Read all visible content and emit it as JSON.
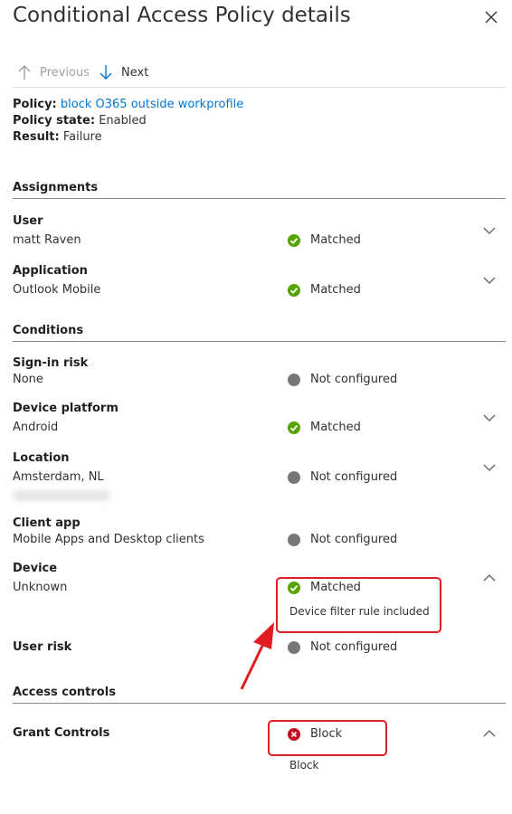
{
  "title": "Conditional Access Policy details",
  "nav": {
    "previous": "Previous",
    "next": "Next"
  },
  "policy": {
    "policy_label": "Policy:",
    "policy_value": "block O365 outside workprofile",
    "state_label": "Policy state:",
    "state_value": "Enabled",
    "result_label": "Result:",
    "result_value": "Failure"
  },
  "sections": {
    "assignments": "Assignments",
    "conditions": "Conditions",
    "access_controls": "Access controls"
  },
  "assignments": [
    {
      "label": "User",
      "value": "matt Raven",
      "status": "Matched"
    },
    {
      "label": "Application",
      "value": "Outlook Mobile",
      "status": "Matched"
    }
  ],
  "conditions": [
    {
      "label": "Sign-in risk",
      "value": "None",
      "status": "Not configured"
    },
    {
      "label": "Device platform",
      "value": "Android",
      "status": "Matched"
    },
    {
      "label": "Location",
      "value": "Amsterdam, NL",
      "status": "Not configured"
    },
    {
      "label": "Client app",
      "value": "Mobile Apps and Desktop clients",
      "status": "Not configured"
    },
    {
      "label": "Device",
      "value": "Unknown",
      "status": "Matched",
      "detail": "Device filter rule included"
    },
    {
      "label": "User risk",
      "status": "Not configured"
    }
  ],
  "grant": {
    "label": "Grant Controls",
    "status": "Block",
    "detail": "Block"
  },
  "colors": {
    "matched": "#57a300",
    "not_configured": "#797775",
    "block": "#c50f1f",
    "link": "#0078d4",
    "highlight": "#e01e22"
  }
}
